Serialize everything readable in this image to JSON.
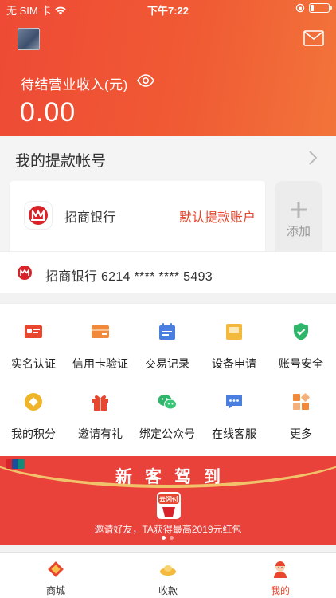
{
  "status_bar": {
    "carrier": "无 SIM 卡",
    "time": "下午7:22"
  },
  "header": {
    "earnings_label": "待结营业收入(元)",
    "earnings_value": "0.00"
  },
  "accounts": {
    "title": "我的提款帐号",
    "card": {
      "bank_name": "招商银行",
      "default_label": "默认提款账户"
    },
    "add_label": "添加"
  },
  "bank_row": {
    "text": "招商银行 6214 **** **** 5493"
  },
  "grid": [
    {
      "label": "实名认证",
      "icon": "id-card-icon",
      "color": "#e8462e"
    },
    {
      "label": "信用卡验证",
      "icon": "credit-card-icon",
      "color": "#f08a3a"
    },
    {
      "label": "交易记录",
      "icon": "calendar-record-icon",
      "color": "#4a7fe0"
    },
    {
      "label": "设备申请",
      "icon": "device-box-icon",
      "color": "#f3b83c"
    },
    {
      "label": "账号安全",
      "icon": "shield-check-icon",
      "color": "#2fb66b"
    },
    {
      "label": "我的积分",
      "icon": "coin-icon",
      "color": "#f0b429"
    },
    {
      "label": "邀请有礼",
      "icon": "gift-icon",
      "color": "#e8462e"
    },
    {
      "label": "绑定公众号",
      "icon": "wechat-icon",
      "color": "#2fb66b"
    },
    {
      "label": "在线客服",
      "icon": "chat-service-icon",
      "color": "#4a7fe0"
    },
    {
      "label": "更多",
      "icon": "more-grid-icon",
      "color": "#f08a3a"
    }
  ],
  "banner": {
    "title": "新客驾到",
    "badge_text": "云闪付",
    "text": "邀请好友，TA获得最高2019元红包"
  },
  "tabs": [
    {
      "label": "商城",
      "icon": "shop-icon"
    },
    {
      "label": "收款",
      "icon": "gold-ingot-icon"
    },
    {
      "label": "我的",
      "icon": "profile-mascot-icon",
      "active": true
    }
  ],
  "colors": {
    "brand": "#ee4a35",
    "accent": "#e8462e"
  }
}
